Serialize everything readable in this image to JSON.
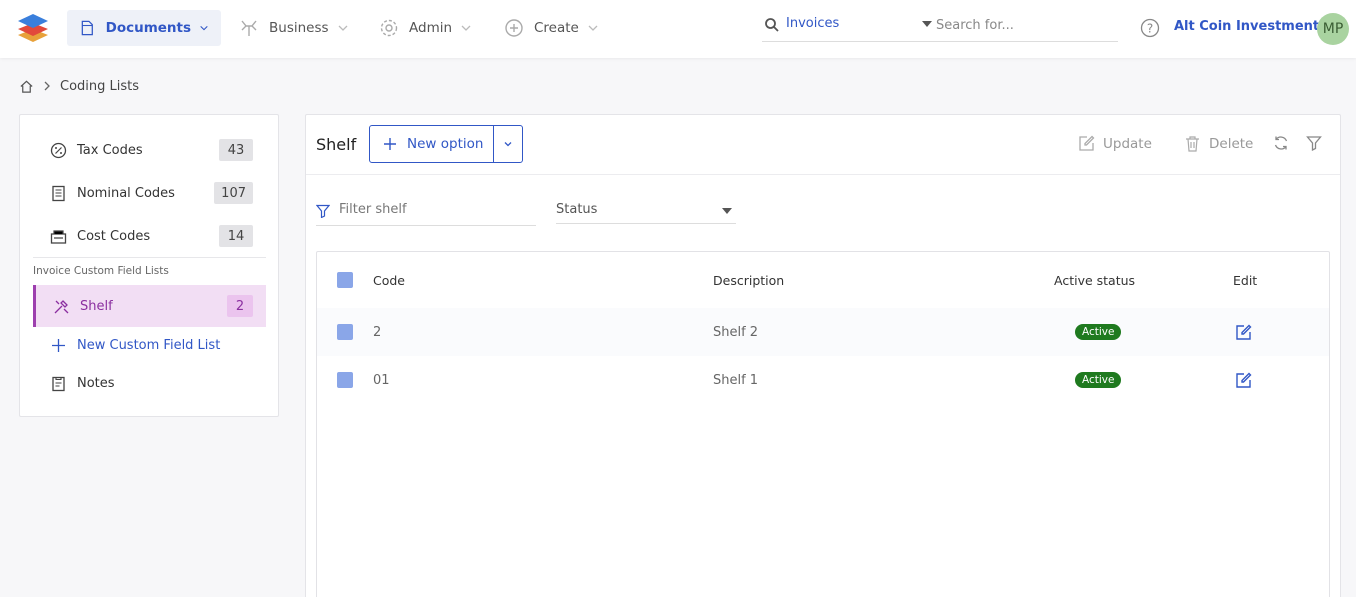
{
  "header": {
    "nav": [
      {
        "label": "Documents",
        "icon": "documents-icon",
        "active": true
      },
      {
        "label": "Business",
        "icon": "business-icon",
        "active": false
      },
      {
        "label": "Admin",
        "icon": "gear-icon",
        "active": false
      },
      {
        "label": "Create",
        "icon": "plus-circle-icon",
        "active": false
      }
    ],
    "search": {
      "scope": "Invoices",
      "placeholder": "Search for..."
    },
    "company": "Alt Coin Investments",
    "avatar_initials": "MP"
  },
  "breadcrumb": {
    "current": "Coding Lists"
  },
  "sidebar": {
    "items": [
      {
        "label": "Tax Codes",
        "count": "43"
      },
      {
        "label": "Nominal Codes",
        "count": "107"
      },
      {
        "label": "Cost Codes",
        "count": "14"
      }
    ],
    "section_label": "Invoice Custom Field Lists",
    "custom_items": [
      {
        "label": "Shelf",
        "count": "2",
        "active": true
      }
    ],
    "new_list_label": "New Custom Field List",
    "notes_label": "Notes"
  },
  "panel": {
    "title": "Shelf",
    "new_option_label": "New option",
    "update_label": "Update",
    "delete_label": "Delete",
    "filter_placeholder": "Filter shelf",
    "status_label": "Status"
  },
  "table": {
    "columns": {
      "code": "Code",
      "description": "Description",
      "active_status": "Active status",
      "edit": "Edit"
    },
    "rows": [
      {
        "code": "2",
        "description": "Shelf 2",
        "status": "Active"
      },
      {
        "code": "01",
        "description": "Shelf 1",
        "status": "Active"
      }
    ]
  },
  "colors": {
    "accent": "#3157c6",
    "active_item": "#8b2fa0",
    "status_active": "#1f7a1f"
  }
}
